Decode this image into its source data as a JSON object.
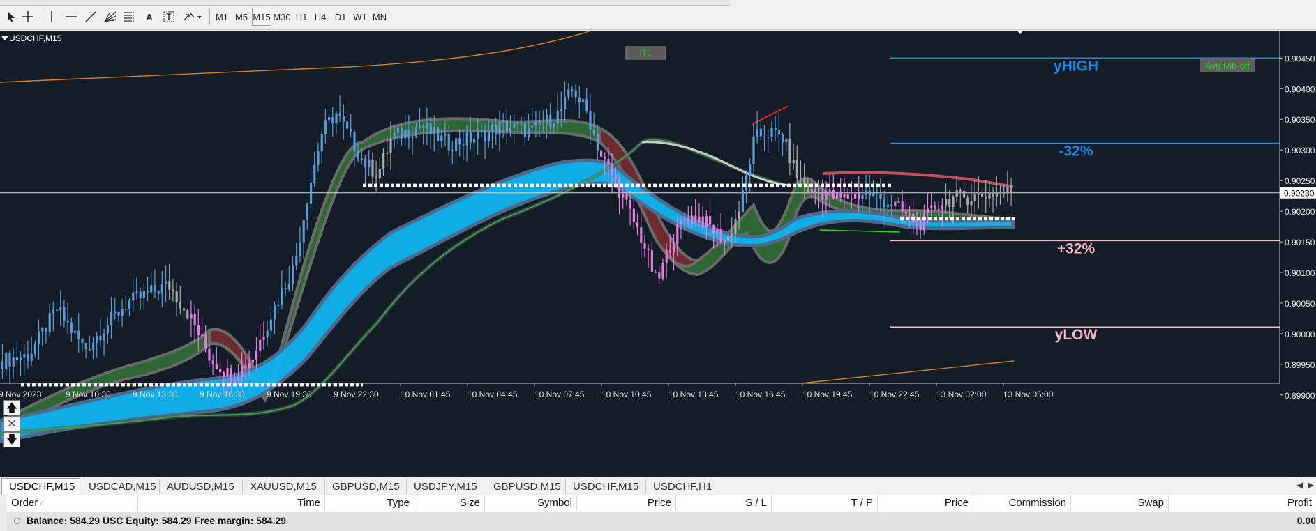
{
  "toolbar": {
    "tools": [
      "cursor-icon",
      "crosshair-icon",
      "vertical-line-icon",
      "horizontal-line-icon",
      "trendline-icon",
      "fibonacci-fan-icon",
      "fibonacci-retracement-icon",
      "text-icon",
      "text-label-icon",
      "arrows-menu-icon"
    ],
    "text_tool": "A",
    "timeframes": [
      "M1",
      "M5",
      "M15",
      "M30",
      "H1",
      "H4",
      "D1",
      "W1",
      "MN"
    ],
    "active_timeframe": "M15"
  },
  "chart": {
    "symbol_label": "USDCHF,M15",
    "itl_button": "ITL",
    "avg_button": "Avg Rib-off",
    "labels": {
      "yhigh": "yHIGH",
      "minus32": "-32%",
      "plus32": "+32%",
      "ylow": "yLOW"
    },
    "current_price": "0.90230",
    "price_ticks": [
      "0.90450",
      "0.90400",
      "0.90350",
      "0.90300",
      "0.90250",
      "0.90200",
      "0.90150",
      "0.90100",
      "0.90050",
      "0.90000",
      "0.89950",
      "0.89900"
    ],
    "time_ticks": [
      "9 Nov 2023",
      "9 Nov 10:30",
      "9 Nov 13:30",
      "9 Nov 16:30",
      "9 Nov 19:30",
      "9 Nov 22:30",
      "10 Nov 01:45",
      "10 Nov 04:45",
      "10 Nov 07:45",
      "10 Nov 10:45",
      "10 Nov 13:45",
      "10 Nov 16:45",
      "10 Nov 19:45",
      "10 Nov 22:45",
      "13 Nov 02:00",
      "13 Nov 05:00"
    ],
    "nav": [
      "arrow-up-icon",
      "close-icon",
      "arrow-down-icon"
    ],
    "colors": {
      "background": "#131c27",
      "bull_candle": "#5b9bd5",
      "bear_candle": "#e07ee0",
      "neutral_candle": "#a8a8a8",
      "yhigh_line": "#1e88e5",
      "ylow_line": "#f2b8c6",
      "ribbon_bull": "#2e6b34",
      "ribbon_bear": "#6e2b2f",
      "ribbon_cyan": "#10b4f0"
    }
  },
  "chart_data": {
    "type": "candlestick",
    "y_axis_range": [
      0.89885,
      0.90472
    ],
    "price_levels": [
      {
        "label": "yHIGH",
        "price": 0.9045
      },
      {
        "label": "-32%",
        "price": 0.90311
      },
      {
        "label": "+32%",
        "price": 0.90152
      },
      {
        "label": "yLOW",
        "price": 0.90011
      }
    ],
    "current_price": 0.9023,
    "support_resistance": [
      0.89917,
      0.90242,
      0.90188
    ]
  },
  "tabs": {
    "items": [
      "USDCHF,M15",
      "USDCAD,M15",
      "AUDUSD,M15",
      "XAUUSD,M15",
      "GBPUSD,M15",
      "USDJPY,M15",
      "GBPUSD,M15",
      "USDCHF,M15",
      "USDCHF,H1"
    ],
    "active_index": 0,
    "scroll_left": "◀",
    "scroll_right": "▶"
  },
  "terminal": {
    "columns": [
      "Order",
      "Time",
      "Type",
      "Size",
      "Symbol",
      "Price",
      "S / L",
      "T / P",
      "Price",
      "Commission",
      "Swap",
      "Profit"
    ],
    "balance_row": "Balance: 584.29 USC  Equity: 584.29  Free margin: 584.29",
    "profit": "0.00"
  }
}
